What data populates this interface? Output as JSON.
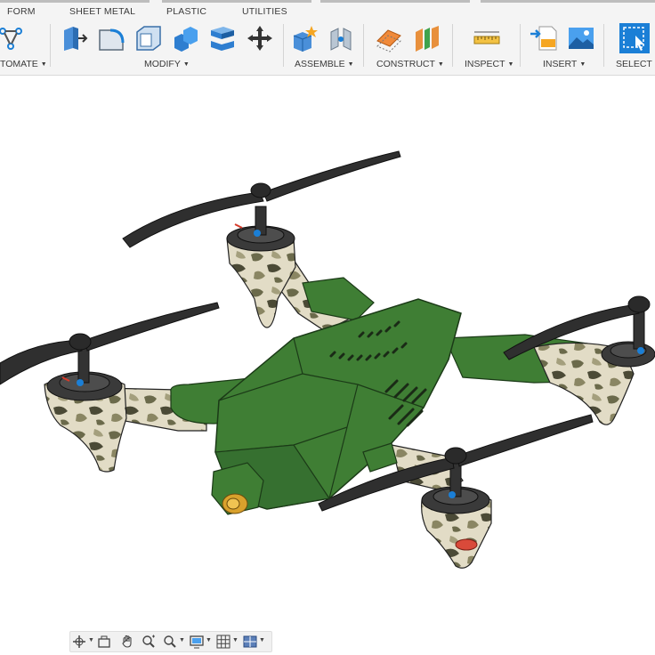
{
  "tabs": [
    {
      "label": "FORM"
    },
    {
      "label": "SHEET METAL"
    },
    {
      "label": "PLASTIC"
    },
    {
      "label": "UTILITIES"
    }
  ],
  "groups": {
    "automate": "TOMATE",
    "modify": "MODIFY",
    "assemble": "ASSEMBLE",
    "construct": "CONSTRUCT",
    "inspect": "INSPECT",
    "insert": "INSERT",
    "select": "SELECT"
  },
  "icons": {
    "automate": "automate-icon",
    "modify": [
      "press-pull-icon",
      "fillet-icon",
      "shell-icon",
      "combine-icon",
      "split-body-icon",
      "move-icon"
    ],
    "assemble": [
      "new-component-icon",
      "joint-icon"
    ],
    "construct": [
      "offset-plane-icon",
      "midplane-icon"
    ],
    "inspect": [
      "measure-icon"
    ],
    "insert": [
      "insert-svg-icon",
      "insert-image-icon"
    ],
    "select": [
      "select-icon"
    ]
  },
  "navbar": {
    "icons": [
      "orbit-icon",
      "look-at-icon",
      "pan-icon",
      "zoom-icon",
      "fit-icon",
      "display-settings-icon",
      "grid-icon",
      "viewports-icon"
    ]
  },
  "colors": {
    "toolbar_bg": "#f4f4f4",
    "canvas_bg": "#ffffff",
    "body_green": "#3f7e34",
    "propeller": "#2e2e2e",
    "camo_light": "#e3ddc8",
    "accent_blue": "#1b7fd6"
  }
}
